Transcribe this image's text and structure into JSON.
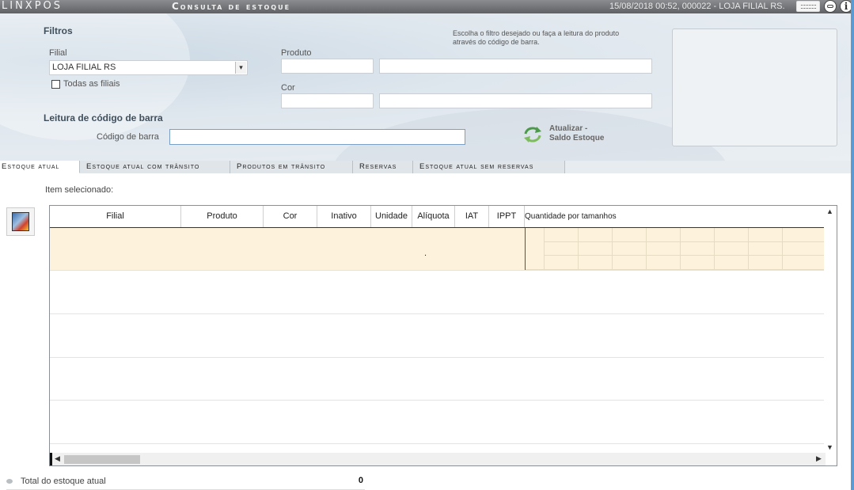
{
  "titlebar": {
    "brand": "LINXPOS",
    "title": "Consulta de estoque",
    "info": "15/08/2018 00:52, 000022 - LOJA FILIAL RS."
  },
  "filters": {
    "header": "Filtros",
    "filial_label": "Filial",
    "filial_value": "LOJA FILIAL RS",
    "all_branches_label": "Todas as filiais",
    "produto_label": "Produto",
    "cor_label": "Cor",
    "hint": "Escolha o filtro desejado ou faça a leitura do produto através do código de barra.",
    "barcode_header": "Leitura de código de barra",
    "barcode_label": "Código de barra",
    "update_label_line1": "Atualizar -",
    "update_label_line2": "Saldo Estoque"
  },
  "tabs": [
    {
      "label": "Estoque atual"
    },
    {
      "label": "Estoque atual com trânsito"
    },
    {
      "label": "Produtos em trânsito"
    },
    {
      "label": "Reservas"
    },
    {
      "label": "Estoque atual sem reservas"
    }
  ],
  "main": {
    "item_selected_label": "Item selecionado:",
    "columns": [
      "Filial",
      "Produto",
      "Cor",
      "Inativo",
      "Unidade",
      "Alíquota",
      "IAT",
      "IPPT",
      "Quantidade por tamanhos"
    ],
    "selected_row_marker": ".",
    "total_label": "Total do estoque atual",
    "total_value": "0"
  },
  "icons": {
    "keyboard": "keyboard-icon",
    "emoji": "emoji-icon",
    "info": "info-icon",
    "refresh": "refresh-icon",
    "film": "film-icon"
  },
  "colors": {
    "titlebar": "#6f7175",
    "panel": "#e2e9ef",
    "selected_row": "#fdf3dc",
    "accent_border": "#7aa0c8"
  }
}
